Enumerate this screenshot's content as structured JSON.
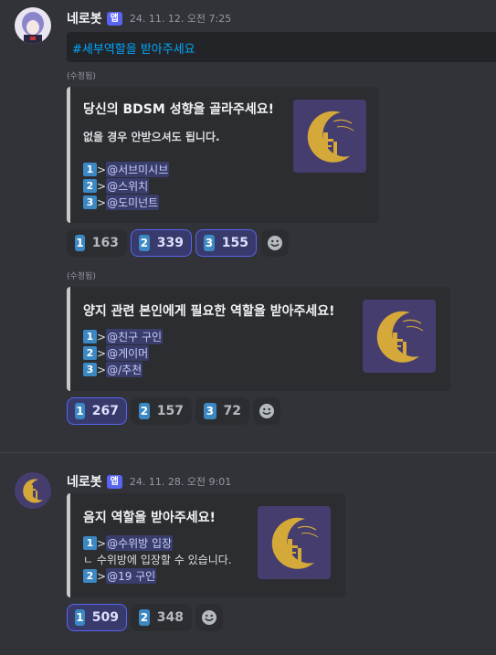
{
  "messages": [
    {
      "author": "네로봇",
      "badge": "앱",
      "timestamp": "24. 11. 12. 오전 7:25",
      "channel_link": "#세부역할을 받아주세요",
      "embeds": [
        {
          "edited": "(수정됨)",
          "title": "당신의 BDSM 성향을 골라주세요!",
          "description": "없을 경우 안받으셔도 됩니다.",
          "roles": [
            {
              "num": "1",
              "gt": ">",
              "mention": "@서브미시브"
            },
            {
              "num": "2",
              "gt": ">",
              "mention": "@스위치"
            },
            {
              "num": "3",
              "gt": ">",
              "mention": "@도미넌트"
            }
          ],
          "reactions": [
            {
              "num": "1",
              "count": "163",
              "me": false
            },
            {
              "num": "2",
              "count": "339",
              "me": true
            },
            {
              "num": "3",
              "count": "155",
              "me": true
            }
          ]
        },
        {
          "edited": "(수정됨)",
          "title": "양지 관련 본인에게 필요한 역할을 받아주세요!",
          "roles": [
            {
              "num": "1",
              "gt": ">",
              "mention": "@친구 구인"
            },
            {
              "num": "2",
              "gt": ">",
              "mention": "@게이머"
            },
            {
              "num": "3",
              "gt": ">",
              "mention": "@/추천"
            }
          ],
          "reactions": [
            {
              "num": "1",
              "count": "267",
              "me": true
            },
            {
              "num": "2",
              "count": "157",
              "me": false
            },
            {
              "num": "3",
              "count": "72",
              "me": false
            }
          ]
        }
      ]
    },
    {
      "author": "네로봇",
      "badge": "앱",
      "timestamp": "24. 11. 28. 오전 9:01",
      "embeds": [
        {
          "title": "음지 역할을 받아주세요!",
          "roles": [
            {
              "num": "1",
              "gt": ">",
              "mention": "@수위방 입장"
            },
            {
              "num": "2",
              "gt": ">",
              "mention": "@19 구인"
            }
          ],
          "subline": "ㄴ 수위방에 입장할 수 있습니다.",
          "reactions": [
            {
              "num": "1",
              "count": "509",
              "me": true
            },
            {
              "num": "2",
              "count": "348",
              "me": false
            }
          ]
        }
      ]
    }
  ],
  "icons": {
    "add_reaction": "smiley-face-icon",
    "thumbnail": "crescent-moon-logo"
  },
  "colors": {
    "blurple": "#5865f2",
    "link": "#00a8fc",
    "keycap": "#3b88c3",
    "logo_bg": "#453d6e",
    "logo_gold": "#d4a93a"
  }
}
